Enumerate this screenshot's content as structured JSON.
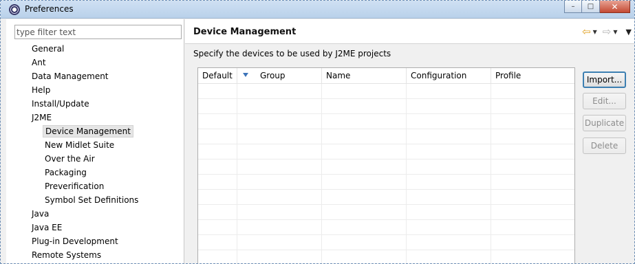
{
  "window": {
    "title": "Preferences",
    "controls": {
      "minimize": "–",
      "maximize": "□",
      "close": "✕"
    }
  },
  "sidebar": {
    "filter_placeholder": "type filter text",
    "items": [
      {
        "label": "General",
        "level": 0
      },
      {
        "label": "Ant",
        "level": 0
      },
      {
        "label": "Data Management",
        "level": 0
      },
      {
        "label": "Help",
        "level": 0
      },
      {
        "label": "Install/Update",
        "level": 0
      },
      {
        "label": "J2ME",
        "level": 0
      },
      {
        "label": "Device Management",
        "level": 1,
        "selected": true
      },
      {
        "label": "New Midlet Suite",
        "level": 1
      },
      {
        "label": "Over the Air",
        "level": 1
      },
      {
        "label": "Packaging",
        "level": 1
      },
      {
        "label": "Preverification",
        "level": 1
      },
      {
        "label": "Symbol Set Definitions",
        "level": 1
      },
      {
        "label": "Java",
        "level": 0
      },
      {
        "label": "Java EE",
        "level": 0
      },
      {
        "label": "Plug-in Development",
        "level": 0
      },
      {
        "label": "Remote Systems",
        "level": 0
      }
    ]
  },
  "main": {
    "title": "Device Management",
    "description": "Specify the devices to be used by J2ME projects",
    "nav": {
      "back_icon": "⇦",
      "forward_icon": "⇨",
      "dropdown_icon": "▼",
      "menu_icon": "▼"
    },
    "table": {
      "columns": [
        "Default",
        "Group",
        "Name",
        "Configuration",
        "Profile"
      ],
      "sorted_column": "Group",
      "sort_direction": "descending",
      "rows": []
    },
    "buttons": {
      "import": "Import...",
      "edit": "Edit...",
      "duplicate": "Duplicate",
      "delete": "Delete"
    }
  },
  "colors": {
    "titlebar": "#b9d1ea",
    "selection": "#e5e5e5",
    "sort_arrow": "#3b73b9",
    "back_arrow": "#e0a020",
    "default_button_border": "#3c7fb1"
  }
}
